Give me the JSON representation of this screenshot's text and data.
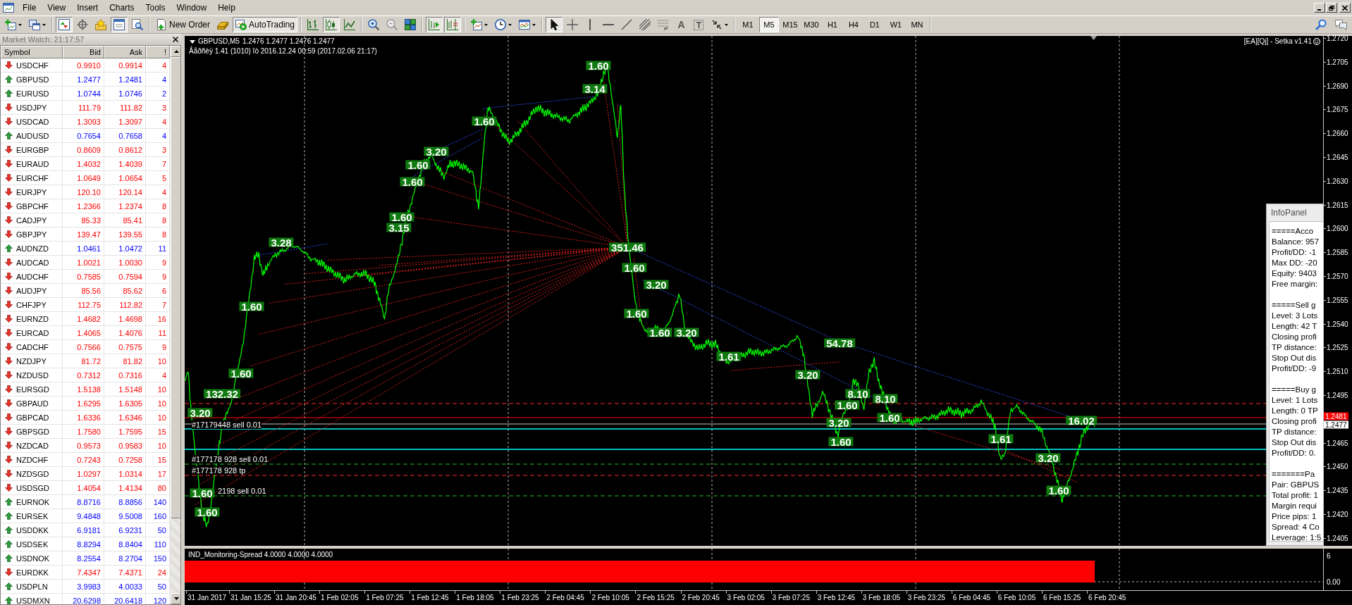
{
  "menu": [
    "File",
    "View",
    "Insert",
    "Charts",
    "Tools",
    "Window",
    "Help"
  ],
  "toolbar": {
    "items": [
      {
        "kind": "newchart",
        "pressed": false
      },
      {
        "kind": "profiles",
        "pressed": false
      },
      {
        "kind": "separator"
      },
      {
        "kind": "marketwatch",
        "pressed": true
      },
      {
        "kind": "datawindow",
        "pressed": false
      },
      {
        "kind": "navigator",
        "pressed": false
      },
      {
        "kind": "terminal",
        "pressed": true
      },
      {
        "kind": "tester",
        "pressed": false
      },
      {
        "kind": "separator"
      },
      {
        "kind": "neworder",
        "label": "New Order",
        "pressed": false
      },
      {
        "kind": "metaeditor",
        "pressed": false
      },
      {
        "kind": "autotrading",
        "label": "AutoTrading",
        "pressed": true
      },
      {
        "kind": "separator"
      },
      {
        "kind": "barchart",
        "pressed": false
      },
      {
        "kind": "candles",
        "pressed": true
      },
      {
        "kind": "linechart",
        "pressed": false
      },
      {
        "kind": "separator"
      },
      {
        "kind": "zoomin",
        "pressed": false
      },
      {
        "kind": "zoomout",
        "pressed": false
      },
      {
        "kind": "tile",
        "pressed": false
      },
      {
        "kind": "separator"
      },
      {
        "kind": "autoscroll",
        "pressed": true
      },
      {
        "kind": "shift",
        "pressed": true
      },
      {
        "kind": "separator"
      },
      {
        "kind": "indicators",
        "pressed": false
      },
      {
        "kind": "periods",
        "pressed": false
      },
      {
        "kind": "templates",
        "pressed": false
      },
      {
        "kind": "separator"
      },
      {
        "kind": "cursor",
        "pressed": true
      },
      {
        "kind": "crosshair",
        "pressed": false
      },
      {
        "kind": "vline",
        "pressed": false
      },
      {
        "kind": "hline",
        "pressed": false
      },
      {
        "kind": "trend",
        "pressed": false
      },
      {
        "kind": "channel",
        "pressed": false
      },
      {
        "kind": "fibo",
        "pressed": false
      },
      {
        "kind": "text",
        "glyph": "A",
        "pressed": false
      },
      {
        "kind": "label",
        "glyph": "T",
        "pressed": false
      },
      {
        "kind": "arrows",
        "pressed": false
      },
      {
        "kind": "separator"
      }
    ],
    "timeframes": [
      {
        "label": "M1",
        "selected": false
      },
      {
        "label": "M5",
        "selected": true
      },
      {
        "label": "M15",
        "selected": false
      },
      {
        "label": "M30",
        "selected": false
      },
      {
        "label": "H1",
        "selected": false
      },
      {
        "label": "H4",
        "selected": false
      },
      {
        "label": "D1",
        "selected": false
      },
      {
        "label": "W1",
        "selected": false
      },
      {
        "label": "MN",
        "selected": false
      }
    ]
  },
  "market_watch": {
    "title": "Market Watch: 21:17:57",
    "columns": [
      "Symbol",
      "Bid",
      "Ask",
      "!"
    ],
    "rows": [
      {
        "symbol": "USDCHF",
        "bid": "0.9910",
        "ask": "0.9914",
        "spread": "4",
        "rising": false
      },
      {
        "symbol": "GBPUSD",
        "bid": "1.2477",
        "ask": "1.2481",
        "spread": "4",
        "rising": true
      },
      {
        "symbol": "EURUSD",
        "bid": "1.0744",
        "ask": "1.0746",
        "spread": "2",
        "rising": true
      },
      {
        "symbol": "USDJPY",
        "bid": "111.79",
        "ask": "111.82",
        "spread": "3",
        "rising": false
      },
      {
        "symbol": "USDCAD",
        "bid": "1.3093",
        "ask": "1.3097",
        "spread": "4",
        "rising": false
      },
      {
        "symbol": "AUDUSD",
        "bid": "0.7654",
        "ask": "0.7658",
        "spread": "4",
        "rising": true
      },
      {
        "symbol": "EURGBP",
        "bid": "0.8609",
        "ask": "0.8612",
        "spread": "3",
        "rising": false
      },
      {
        "symbol": "EURAUD",
        "bid": "1.4032",
        "ask": "1.4039",
        "spread": "7",
        "rising": false
      },
      {
        "symbol": "EURCHF",
        "bid": "1.0649",
        "ask": "1.0654",
        "spread": "5",
        "rising": false
      },
      {
        "symbol": "EURJPY",
        "bid": "120.10",
        "ask": "120.14",
        "spread": "4",
        "rising": false
      },
      {
        "symbol": "GBPCHF",
        "bid": "1.2366",
        "ask": "1.2374",
        "spread": "8",
        "rising": false
      },
      {
        "symbol": "CADJPY",
        "bid": "85.33",
        "ask": "85.41",
        "spread": "8",
        "rising": false
      },
      {
        "symbol": "GBPJPY",
        "bid": "139.47",
        "ask": "139.55",
        "spread": "8",
        "rising": false
      },
      {
        "symbol": "AUDNZD",
        "bid": "1.0461",
        "ask": "1.0472",
        "spread": "11",
        "rising": true
      },
      {
        "symbol": "AUDCAD",
        "bid": "1.0021",
        "ask": "1.0030",
        "spread": "9",
        "rising": false
      },
      {
        "symbol": "AUDCHF",
        "bid": "0.7585",
        "ask": "0.7594",
        "spread": "9",
        "rising": false
      },
      {
        "symbol": "AUDJPY",
        "bid": "85.56",
        "ask": "85.62",
        "spread": "6",
        "rising": false
      },
      {
        "symbol": "CHFJPY",
        "bid": "112.75",
        "ask": "112.82",
        "spread": "7",
        "rising": false
      },
      {
        "symbol": "EURNZD",
        "bid": "1.4682",
        "ask": "1.4698",
        "spread": "16",
        "rising": false
      },
      {
        "symbol": "EURCAD",
        "bid": "1.4065",
        "ask": "1.4076",
        "spread": "11",
        "rising": false
      },
      {
        "symbol": "CADCHF",
        "bid": "0.7566",
        "ask": "0.7575",
        "spread": "9",
        "rising": false
      },
      {
        "symbol": "NZDJPY",
        "bid": "81.72",
        "ask": "81.82",
        "spread": "10",
        "rising": false
      },
      {
        "symbol": "NZDUSD",
        "bid": "0.7312",
        "ask": "0.7316",
        "spread": "4",
        "rising": false
      },
      {
        "symbol": "EURSGD",
        "bid": "1.5138",
        "ask": "1.5148",
        "spread": "10",
        "rising": false
      },
      {
        "symbol": "GBPAUD",
        "bid": "1.6295",
        "ask": "1.6305",
        "spread": "10",
        "rising": false
      },
      {
        "symbol": "GBPCAD",
        "bid": "1.6336",
        "ask": "1.6346",
        "spread": "10",
        "rising": false
      },
      {
        "symbol": "GBPSGD",
        "bid": "1.7580",
        "ask": "1.7595",
        "spread": "15",
        "rising": false
      },
      {
        "symbol": "NZDCAD",
        "bid": "0.9573",
        "ask": "0.9583",
        "spread": "10",
        "rising": false
      },
      {
        "symbol": "NZDCHF",
        "bid": "0.7243",
        "ask": "0.7258",
        "spread": "15",
        "rising": false
      },
      {
        "symbol": "NZDSGD",
        "bid": "1.0297",
        "ask": "1.0314",
        "spread": "17",
        "rising": false
      },
      {
        "symbol": "USDSGD",
        "bid": "1.4054",
        "ask": "1.4134",
        "spread": "80",
        "rising": false
      },
      {
        "symbol": "EURNOK",
        "bid": "8.8716",
        "ask": "8.8856",
        "spread": "140",
        "rising": true
      },
      {
        "symbol": "EURSEK",
        "bid": "9.4848",
        "ask": "9.5008",
        "spread": "160",
        "rising": true
      },
      {
        "symbol": "USDDKK",
        "bid": "6.9181",
        "ask": "6.9231",
        "spread": "50",
        "rising": true
      },
      {
        "symbol": "USDSEK",
        "bid": "8.8294",
        "ask": "8.8404",
        "spread": "110",
        "rising": true
      },
      {
        "symbol": "USDNOK",
        "bid": "8.2554",
        "ask": "8.2704",
        "spread": "150",
        "rising": true
      },
      {
        "symbol": "EURDKK",
        "bid": "7.4347",
        "ask": "7.4371",
        "spread": "24",
        "rising": false
      },
      {
        "symbol": "USDPLN",
        "bid": "3.9983",
        "ask": "4.0033",
        "spread": "50",
        "rising": true
      },
      {
        "symbol": "USDMXN",
        "bid": "20.6298",
        "ask": "20.6418",
        "spread": "120",
        "rising": true
      }
    ]
  },
  "chart": {
    "symbol": "GBPUSD,M5",
    "ohlc": "1.2476 1.2477 1.2476 1.2477",
    "version_line": "Âåðñèÿ 1.41 (1010) îò 2016.12.24 00:59 (2017.02.06 21:17)",
    "expert": "[EA][Qj] - Setka v1.41",
    "labels": [
      "1.60",
      "3.14",
      "1.60",
      "3.20",
      "1.60",
      "1.60",
      "1.60",
      "3.15",
      "3.28",
      "351.46",
      "1.60",
      "3.20",
      "1.60",
      "1.60",
      "3.20",
      "1.61",
      "54.78",
      "3.20",
      "1.60",
      "1.60",
      "132.32",
      "3.20",
      "8.10",
      "1.60",
      "8.10",
      "3.20",
      "1.60",
      "1.60",
      "1.61",
      "3.20",
      "16.02",
      "1.60",
      "1.60",
      "1.60"
    ],
    "order_notes": [
      "#17179448 sell 0.01",
      "#177178 928 sell 0.01",
      "#177178 928 tp",
      "2198 sell 0.01"
    ],
    "price_axis": {
      "labels": [
        "1.2720",
        "1.2705",
        "1.2690",
        "1.2675",
        "1.2660",
        "1.2645",
        "1.2630",
        "1.2615",
        "1.2600",
        "1.2585",
        "1.2570",
        "1.2555",
        "1.2540",
        "1.2525",
        "1.2510",
        "1.2495",
        "1.2465",
        "1.2450",
        "1.2435",
        "1.2420",
        "1.2405"
      ],
      "ask": "1.2481",
      "bid": "1.2477"
    },
    "indicator": {
      "label": "IND_Monitoring-Spread 4.0000 4.0000 4.0000",
      "axis": [
        "6",
        "0.00"
      ]
    },
    "time_axis": {
      "labels": [
        "31 Jan 2017",
        "31 Jan 15:25",
        "31 Jan 20:45",
        "1 Feb 02:05",
        "1 Feb 07:25",
        "1 Feb 12:45",
        "1 Feb 18:05",
        "1 Feb 23:25",
        "2 Feb 04:45",
        "2 Feb 10:05",
        "2 Feb 15:25",
        "2 Feb 20:45",
        "3 Feb 02:05",
        "3 Feb 07:25",
        "3 Feb 12:45",
        "3 Feb 18:05",
        "3 Feb 23:25",
        "6 Feb 04:45",
        "6 Feb 10:05",
        "6 Feb 15:25",
        "6 Feb 20:45"
      ]
    }
  },
  "info_panel": {
    "title": "InfoPanel",
    "sections": [
      [
        "=====Acco",
        "Balance: 957",
        "Profit/DD: -1",
        "Max DD: -20",
        "Equity: 9403",
        "Free margin:"
      ],
      [
        "=====Sell g",
        "Level: 3 Lots",
        "Length: 42 T",
        "Closing profi",
        "TP distance:",
        "Stop Out dis",
        "Profit/DD: -9"
      ],
      [
        "=====Buy g",
        "Level: 1 Lots",
        "Length: 0 TP",
        "Closing profi",
        "TP distance:",
        "Stop Out dis",
        "Profit/DD: 0."
      ],
      [
        "=======Pa",
        "Pair: GBPUS",
        "Total profit: 1",
        "Margin requi",
        "Price pips: 1",
        "Spread: 4 Co",
        "Leverage: 1:5"
      ]
    ]
  }
}
